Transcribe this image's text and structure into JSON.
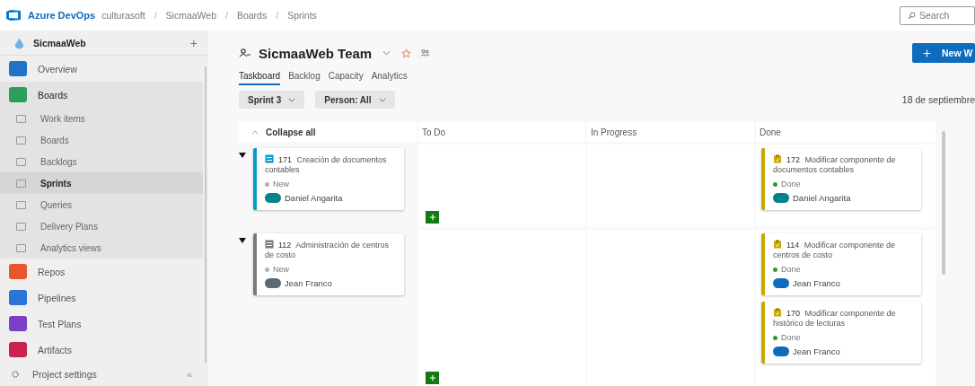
{
  "breadcrumb": {
    "product": "Azure DevOps",
    "items": [
      "culturasoft",
      "SicmaaWeb",
      "Boards",
      "Sprints"
    ],
    "separator": "/"
  },
  "search": {
    "placeholder": "Search"
  },
  "sidebar": {
    "project": "SicmaaWeb",
    "add": "+",
    "collapse": "«",
    "settings": "Project settings",
    "items": [
      {
        "label": "Overview",
        "kind": "overview",
        "selected": false,
        "expanded": false
      },
      {
        "label": "Boards",
        "kind": "boards",
        "selected": false,
        "expanded": true,
        "children": [
          {
            "label": "Work items",
            "selected": false
          },
          {
            "label": "Boards",
            "selected": false
          },
          {
            "label": "Backlogs",
            "selected": false
          },
          {
            "label": "Sprints",
            "selected": true
          },
          {
            "label": "Queries",
            "selected": false
          },
          {
            "label": "Delivery Plans",
            "selected": false
          },
          {
            "label": "Analytics views",
            "selected": false
          }
        ]
      },
      {
        "label": "Repos",
        "kind": "repos",
        "selected": false,
        "expanded": false
      },
      {
        "label": "Pipelines",
        "kind": "pipelines",
        "selected": false,
        "expanded": false
      },
      {
        "label": "Test Plans",
        "kind": "testplans",
        "selected": false,
        "expanded": false
      },
      {
        "label": "Artifacts",
        "kind": "artifacts",
        "selected": false,
        "expanded": false
      }
    ]
  },
  "team": {
    "title": "SicmaaWeb Team",
    "favorite": false
  },
  "tabs": [
    {
      "label": "Taskboard",
      "selected": true
    },
    {
      "label": "Backlog",
      "selected": false
    },
    {
      "label": "Capacity",
      "selected": false
    },
    {
      "label": "Analytics",
      "selected": false
    }
  ],
  "filters": [
    "Sprint 3",
    "Person: All"
  ],
  "new_button": "New W",
  "date": "18 de septiembre",
  "board": {
    "collapse": "Collapse all",
    "columns": [
      "To Do",
      "In Progress",
      "Done"
    ],
    "rows": [
      {
        "expanded": true,
        "parent": {
          "id": "171",
          "title": "Creación de documentos contables",
          "color": "#009ccc",
          "state": {
            "text": "New",
            "color": "#b2b2b2"
          },
          "assignee": {
            "name": "Daniel Angarita",
            "color": "#038387"
          }
        },
        "cells": [
          [],
          [],
          [
            {
              "id": "172",
              "title": "Modificar componente de documentos contables",
              "color": "#c9a800",
              "state": {
                "text": "Done",
                "color": "#339933"
              },
              "assignee": {
                "name": "Daniel Angarita",
                "color": "#038387"
              }
            }
          ]
        ]
      },
      {
        "expanded": true,
        "parent": {
          "id": "112",
          "title": "Administración de centros de costo",
          "color": "#7a7a7a",
          "state": {
            "text": "New",
            "color": "#b2b2b2"
          },
          "assignee": {
            "name": "Jean Franco",
            "color": "#5c6970"
          }
        },
        "cells": [
          [],
          [],
          [
            {
              "id": "114",
              "title": "Modificar componente de centros de costo",
              "color": "#c9a800",
              "state": {
                "text": "Done",
                "color": "#339933"
              },
              "assignee": {
                "name": "Jean Franco",
                "color": "#0f6cbd"
              }
            },
            {
              "id": "170",
              "title": "Modificar componente de histórico de lecturas",
              "color": "#c9a800",
              "state": {
                "text": "Done",
                "color": "#339933"
              },
              "assignee": {
                "name": "Jean Franco",
                "color": "#0f6cbd"
              }
            }
          ]
        ]
      }
    ]
  }
}
